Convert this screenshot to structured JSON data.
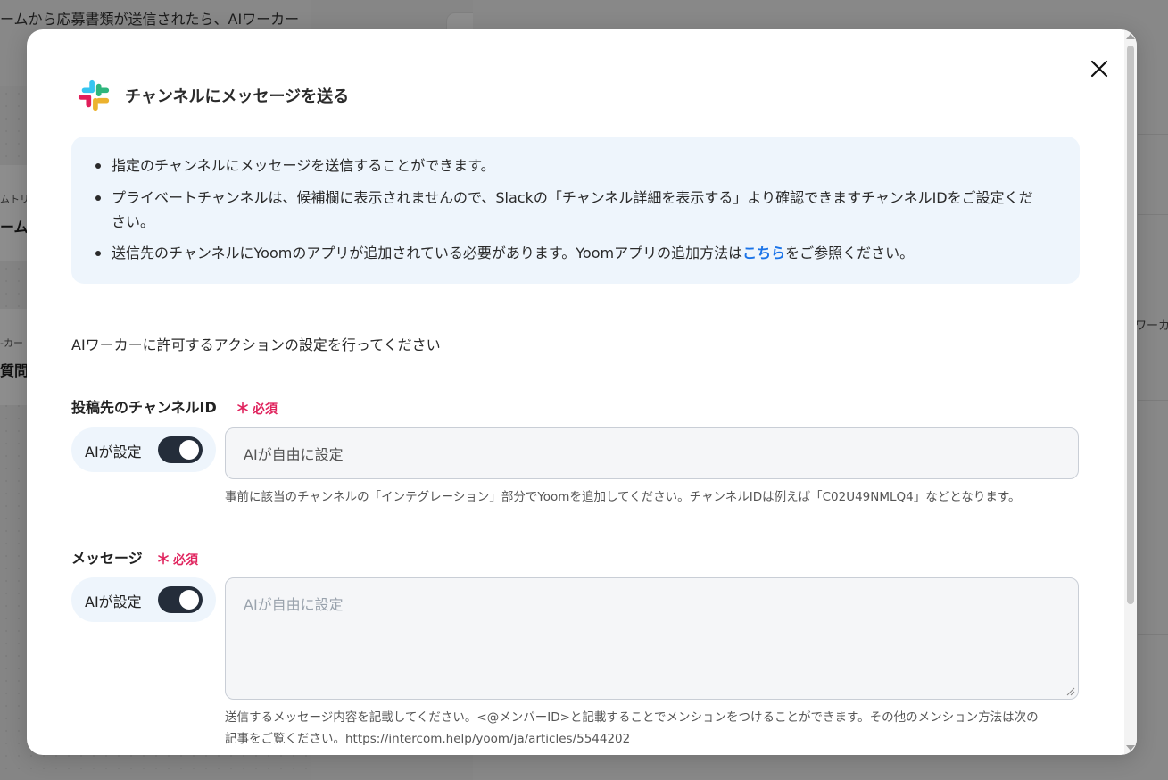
{
  "background": {
    "page_title": "ームから応募書類が送信されたら、AIワーカー",
    "card1_small": "ムトリ",
    "card1_big": "ーム",
    "card2_small": "-カー",
    "card2_big": "質問",
    "right_text": "ワーカ"
  },
  "modal": {
    "title": "チャンネルにメッセージを送る",
    "app_icon": "slack-logo",
    "close_icon": "close-icon",
    "info": {
      "item1": "指定のチャンネルにメッセージを送信することができます。",
      "item2_line1": "プライベートチャンネルは、候補欄に表示されませんので、Slackの「チャンネル詳細を表示する」より確認できますチャンネルIDをご設定くだ",
      "item2_line2": "さい。",
      "item3_before": "送信先のチャンネルにYoomのアプリが追加されている必要があります。Yoomアプリの追加方法は",
      "item3_link": "こちら",
      "item3_after": "をご参照ください。"
    },
    "section_description": "AIワーカーに許可するアクションの設定を行ってください",
    "fields": {
      "channel_id": {
        "label": "投稿先のチャンネルID",
        "required": "必須",
        "ai_toggle_label": "AIが設定",
        "ai_toggle_on": true,
        "value": "AIが自由に設定",
        "hint": "事前に該当のチャンネルの「インテグレーション」部分でYoomを追加してください。チャンネルIDは例えば「C02U49NMLQ4」などとなります。"
      },
      "message": {
        "label": "メッセージ",
        "required": "必須",
        "ai_toggle_label": "AIが設定",
        "ai_toggle_on": true,
        "placeholder": "AIが自由に設定",
        "hint_line1": "送信するメッセージ内容を記載してください。<@メンバーID>と記載することでメンションをつけることができます。その他のメンション方法は次の",
        "hint_line2": "記事をご覧ください。https://intercom.help/yoom/ja/articles/5544202"
      }
    }
  },
  "colors": {
    "required": "#e0245e",
    "link": "#1a73e8",
    "toggle_on": "#242d3a",
    "info_bg": "#eef5fc"
  }
}
